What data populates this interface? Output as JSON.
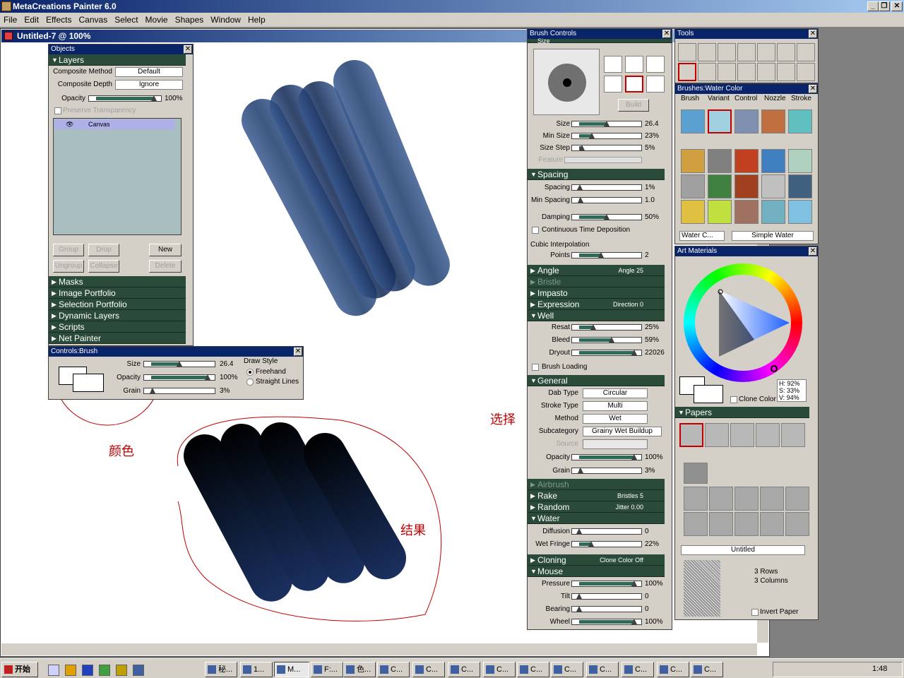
{
  "app": {
    "title": "MetaCreations Painter 6.0"
  },
  "menu": [
    "File",
    "Edit",
    "Effects",
    "Canvas",
    "Select",
    "Movie",
    "Shapes",
    "Window",
    "Help"
  ],
  "document": {
    "title": "Untitled-7 @ 100%"
  },
  "objects": {
    "title": "Objects",
    "layers_header": "Layers",
    "composite_method_label": "Composite Method",
    "composite_method": "Default",
    "composite_depth_label": "Composite Depth",
    "composite_depth": "Ignore",
    "opacity_label": "Opacity",
    "opacity": "100%",
    "opacity_fraction": 1.0,
    "preserve": "Preserve Transparency",
    "layer_name": "Canvas",
    "buttons": {
      "group": "Group",
      "drop": "Drop",
      "new": "New",
      "ungroup": "Ungroup",
      "collapse": "Collapse",
      "delete": "Delete"
    },
    "sections": [
      "Masks",
      "Image Portfolio",
      "Selection Portfolio",
      "Dynamic Layers",
      "Scripts",
      "Net Painter"
    ]
  },
  "controls_brush": {
    "title": "Controls:Brush",
    "size_label": "Size",
    "size": "26.4",
    "size_fraction": 0.5,
    "opacity_label": "Opacity",
    "opacity": "100%",
    "opacity_fraction": 1.0,
    "grain_label": "Grain",
    "grain": "3%",
    "grain_fraction": 0.03,
    "draw_style": "Draw Style",
    "freehand": "Freehand",
    "straight": "Straight Lines"
  },
  "brush_controls": {
    "title": "Brush Controls",
    "size_sect": "Size",
    "build": "Build",
    "size": {
      "label": "Size",
      "value": "26.4",
      "f": 0.5
    },
    "min_size": {
      "label": "Min Size",
      "value": "23%",
      "f": 0.23
    },
    "size_step": {
      "label": "Size Step",
      "value": "5%",
      "f": 0.05
    },
    "feature": "Feature",
    "spacing_sect": "Spacing",
    "spacing": {
      "label": "Spacing",
      "value": "1%",
      "f": 0.01
    },
    "min_spacing": {
      "label": "Min Spacing",
      "value": "1.0",
      "f": 0.02
    },
    "damping": {
      "label": "Damping",
      "value": "50%",
      "f": 0.5
    },
    "continuous": "Continuous Time Deposition",
    "cubic": "Cubic Interpolation",
    "points": {
      "label": "Points",
      "value": "2",
      "f": 0.4
    },
    "angle_sect": "Angle",
    "angle_val": "Angle 25",
    "bristle_sect": "Bristle",
    "impasto_sect": "Impasto",
    "expression_sect": "Expression",
    "expression_val": "Direction 0",
    "well_sect": "Well",
    "resat": {
      "label": "Resat",
      "value": "25%",
      "f": 0.25
    },
    "bleed": {
      "label": "Bleed",
      "value": "59%",
      "f": 0.59
    },
    "dryout": {
      "label": "Dryout",
      "value": "22026",
      "f": 1.0
    },
    "brush_loading": "Brush Loading",
    "general_sect": "General",
    "dab_type_label": "Dab Type",
    "dab_type": "Circular",
    "stroke_type_label": "Stroke Type",
    "stroke_type": "Multi",
    "method_label": "Method",
    "method": "Wet",
    "subcategory_label": "Subcategory",
    "subcategory": "Grainy Wet Buildup",
    "source_label": "Source",
    "g_opacity": {
      "label": "Opacity",
      "value": "100%",
      "f": 1.0
    },
    "g_grain": {
      "label": "Grain",
      "value": "3%",
      "f": 0.03
    },
    "airbrush_sect": "Airbrush",
    "rake_sect": "Rake",
    "rake_val": "Bristles 5",
    "random_sect": "Random",
    "random_val": "Jitter 0.00",
    "water_sect": "Water",
    "diffusion": {
      "label": "Diffusion",
      "value": "0",
      "f": 0.0
    },
    "wet_fringe": {
      "label": "Wet Fringe",
      "value": "22%",
      "f": 0.22
    },
    "cloning_sect": "Cloning",
    "cloning_val": "Clone Color Off",
    "mouse_sect": "Mouse",
    "pressure": {
      "label": "Pressure",
      "value": "100%",
      "f": 1.0
    },
    "tilt": {
      "label": "Tilt",
      "value": "0",
      "f": 0.0
    },
    "bearing": {
      "label": "Bearing",
      "value": "0",
      "f": 0.0
    },
    "wheel": {
      "label": "Wheel",
      "value": "100%",
      "f": 1.0
    }
  },
  "tools": {
    "title": "Tools"
  },
  "brushes": {
    "title": "Brushes:Water Color",
    "tabs": [
      "Brush",
      "Variant",
      "Control",
      "Nozzle",
      "Stroke"
    ],
    "category": "Water C...",
    "variant": "Simple Water"
  },
  "art_materials": {
    "title": "Art Materials",
    "h": "H: 92%",
    "s": "S: 33%",
    "v": "V: 94%",
    "clone_color": "Clone Color",
    "papers": "Papers",
    "paper_name": "Untitled",
    "rows": "3 Rows",
    "cols": "3 Columns",
    "invert": "Invert Paper"
  },
  "annotations": {
    "color": "颜色",
    "select": "选择",
    "result": "结果"
  },
  "taskbar": {
    "start": "开始",
    "items": [
      "秘...",
      "1...",
      "M...",
      "F:...",
      "色...",
      "C...",
      "C...",
      "C...",
      "C...",
      "C...",
      "C...",
      "C...",
      "C...",
      "C...",
      "C..."
    ],
    "clock": "1:48"
  },
  "colors": {
    "titlebar": "#0a246a",
    "section": "#2a4a3a",
    "slider_fill": "#2f6a55",
    "stroke_blue": "#1a3a6a",
    "stroke_dark": "#0a1528",
    "annotation": "#c00000"
  }
}
